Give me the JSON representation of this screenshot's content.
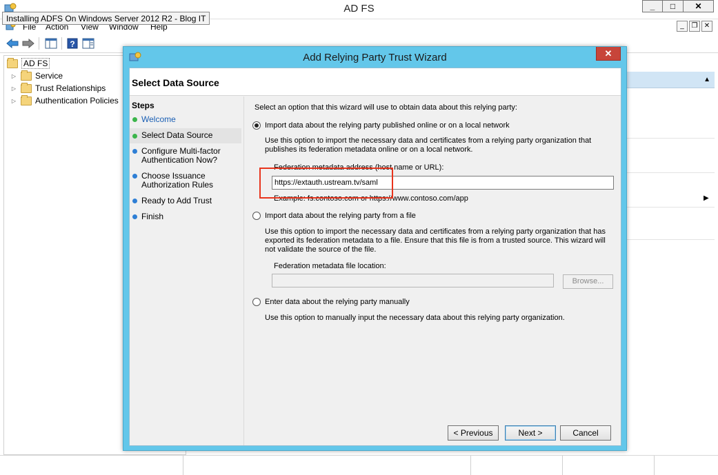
{
  "mmc": {
    "title": "AD FS",
    "tooltip": "Installing ADFS On Windows Server 2012 R2 - Blog IT",
    "window_buttons": {
      "minimize": "_",
      "maximize": "□",
      "close": "✕"
    },
    "menu": [
      "File",
      "Action",
      "View",
      "Window",
      "Help"
    ],
    "mdi_buttons": {
      "minimize": "_",
      "restore": "❐",
      "close": "✕"
    }
  },
  "tree": {
    "root": "AD FS",
    "children": [
      "Service",
      "Trust Relationships",
      "Authentication Policies"
    ]
  },
  "wizard": {
    "title": "Add Relying Party Trust Wizard",
    "close": "✕",
    "page_title": "Select Data Source",
    "steps_title": "Steps",
    "steps": [
      {
        "label": "Welcome",
        "status": "done-link"
      },
      {
        "label": "Select Data Source",
        "status": "current"
      },
      {
        "label": "Configure Multi-factor\nAuthentication Now?",
        "status": "pending"
      },
      {
        "label": "Choose Issuance\nAuthorization Rules",
        "status": "pending"
      },
      {
        "label": "Ready to Add Trust",
        "status": "pending"
      },
      {
        "label": "Finish",
        "status": "pending"
      }
    ],
    "intro": "Select an option that this wizard will use to obtain data about this relying party:",
    "option_online": {
      "label": "Import data about the relying party published online or on a local network",
      "checked": true,
      "description": "Use this option to import the necessary data and certificates from a relying party organization that publishes its federation metadata online or on a local network.",
      "field_label": "Federation metadata address (host name or URL):",
      "field_value": "https://extauth.ustream.tv/saml",
      "example": "Example: fs.contoso.com or https://www.contoso.com/app"
    },
    "option_file": {
      "label": "Import data about the relying party from a file",
      "checked": false,
      "description": "Use this option to import the necessary data and certificates from a relying party organization that has exported its federation metadata to a file. Ensure that this file is from a trusted source.  This wizard will not validate the source of the file.",
      "field_label": "Federation metadata file location:",
      "field_value": "",
      "browse": "Browse..."
    },
    "option_manual": {
      "label": "Enter data about the relying party manually",
      "checked": false,
      "description": "Use this option to manually input the necessary data about this relying party organization."
    },
    "buttons": {
      "previous": "< Previous",
      "next": "Next >",
      "cancel": "Cancel"
    }
  },
  "colors": {
    "wizard_frame": "#63c7ea",
    "close_button": "#c7453a",
    "step_done": "#3bb54a",
    "step_pending": "#2f7fd5",
    "highlight": "#e8341c"
  }
}
